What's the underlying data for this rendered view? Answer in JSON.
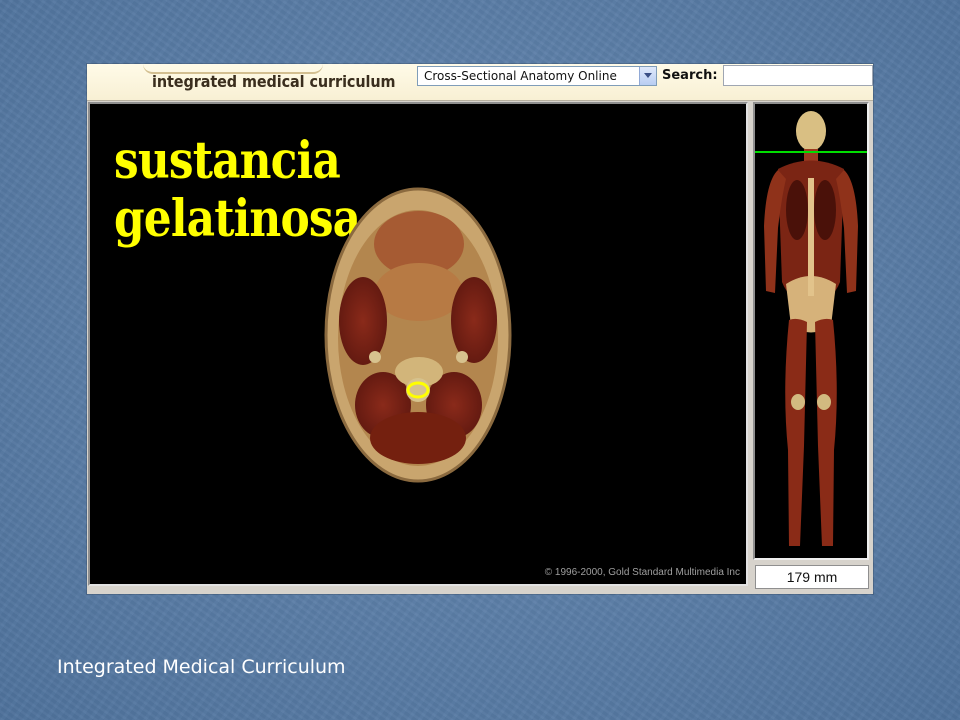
{
  "header": {
    "brand": "integrated medical curriculum",
    "atlas_select_value": "Cross-Sectional Anatomy Online",
    "search_label": "Search:",
    "search_value": ""
  },
  "viewer": {
    "structure_label_line1": "sustancia",
    "structure_label_line2": "gelatinosa",
    "copyright": "© 1996-2000, Gold Standard Multimedia Inc"
  },
  "sidebar": {
    "depth_readout": "179 mm"
  },
  "slide": {
    "footer_caption": "Integrated Medical Curriculum"
  },
  "colors": {
    "label_yellow": "#ffff00",
    "slice_line_green": "#00dd00",
    "viewer_background": "#000000"
  },
  "icons": {
    "select_arrow": "chevron-down-icon"
  }
}
